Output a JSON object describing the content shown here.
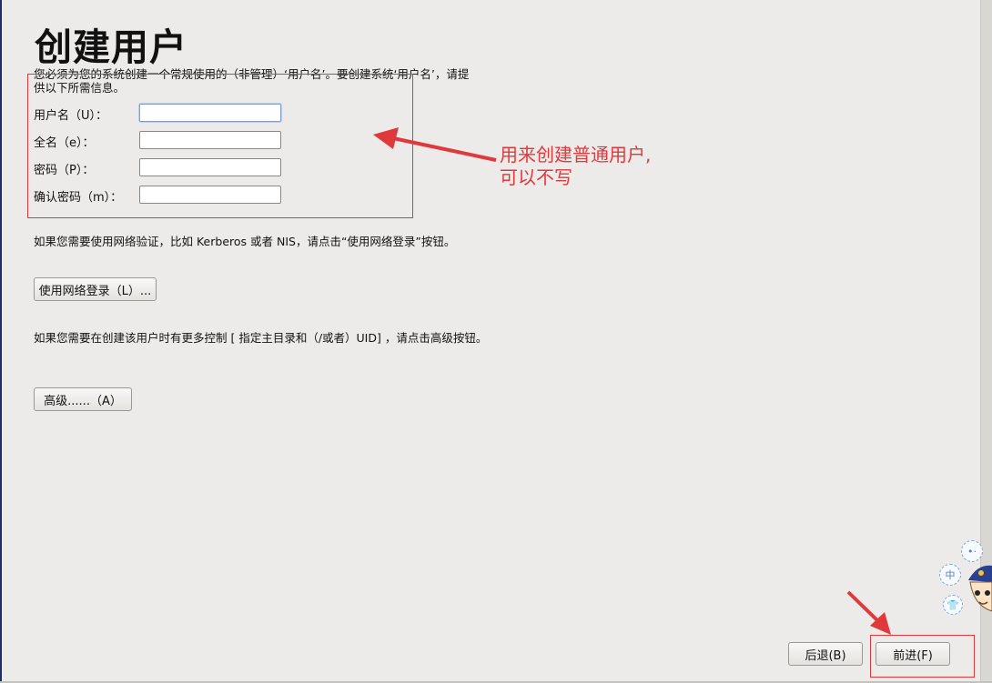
{
  "page": {
    "title": "创建用户",
    "intro": "您必须为您的系统创建一个常规使用的（非管理）‘用户名’。要创建系统‘用户名’，请提供以下所需信息。"
  },
  "form": {
    "username_label": "用户名（U）：",
    "fullname_label": "全名（e）：",
    "password_label": "密码（P）：",
    "confirm_label": "确认密码（m）：",
    "username_value": "",
    "fullname_value": "",
    "password_value": "",
    "confirm_value": ""
  },
  "network": {
    "hint": "如果您需要使用网络验证，比如 Kerberos 或者 NIS，请点击“使用网络登录”按钮。",
    "button_label": "使用网络登录（L）..."
  },
  "advanced": {
    "hint": "如果您需要在创建该用户时有更多控制 [ 指定主目录和（/或者）UID] ，请点击高级按钮。",
    "button_label": "高级......（A）"
  },
  "footer": {
    "back_label": "后退(B)",
    "next_label": "前进(F)"
  },
  "annotation": {
    "line1": "用来创建普通用户,",
    "line2": "可以不写",
    "color": "#e0393b"
  },
  "sticker": {
    "ime_label": "中"
  }
}
